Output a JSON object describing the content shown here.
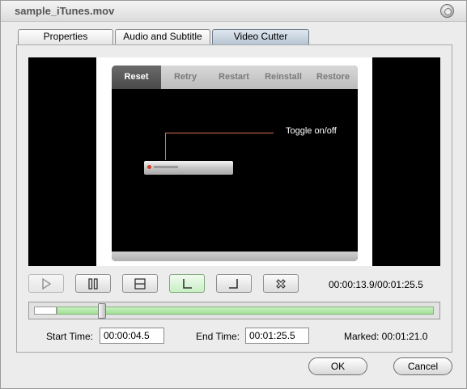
{
  "window": {
    "title": "sample_iTunes.mov"
  },
  "tabs": [
    {
      "label": "Properties"
    },
    {
      "label": "Audio and Subtitle"
    },
    {
      "label": "Video Cutter"
    }
  ],
  "active_tab": "Video Cutter",
  "preview": {
    "menu": [
      "Reset",
      "Retry",
      "Restart",
      "Reinstall",
      "Restore"
    ],
    "active_menu": "Reset",
    "callout": "Toggle on/off"
  },
  "controls": {
    "buttons": [
      "play-icon",
      "pause-icon",
      "stop-icon",
      "mark-in-icon",
      "mark-out-icon",
      "clear-marks-icon"
    ],
    "time_display": "00:00:13.9/00:01:25.5"
  },
  "slider": {
    "position_seconds": 13.9,
    "duration_seconds": 85.5,
    "selection_start_seconds": 4.5,
    "selection_end_seconds": 85.5
  },
  "trim": {
    "start_label": "Start Time:",
    "start_value": "00:00:04.5",
    "end_label": "End Time:",
    "end_value": "00:01:25.5",
    "marked": "Marked: 00:01:21.0"
  },
  "footer": {
    "ok_label": "OK",
    "cancel_label": "Cancel"
  },
  "colors": {
    "selection_green": "#a3e096",
    "video_bg": "#000000",
    "active_tab": "#b7c5d3"
  }
}
